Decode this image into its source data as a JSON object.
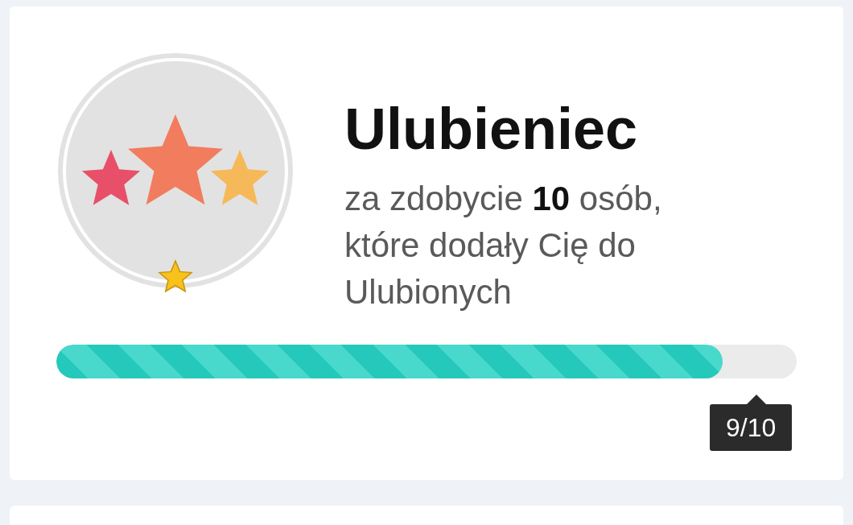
{
  "badge": {
    "title": "Ulubieniec",
    "description": "za zdobycie **10** osób, które dodały Cię do Ulubionych",
    "level": 0.9,
    "tooltip": "9/10"
  }
}
